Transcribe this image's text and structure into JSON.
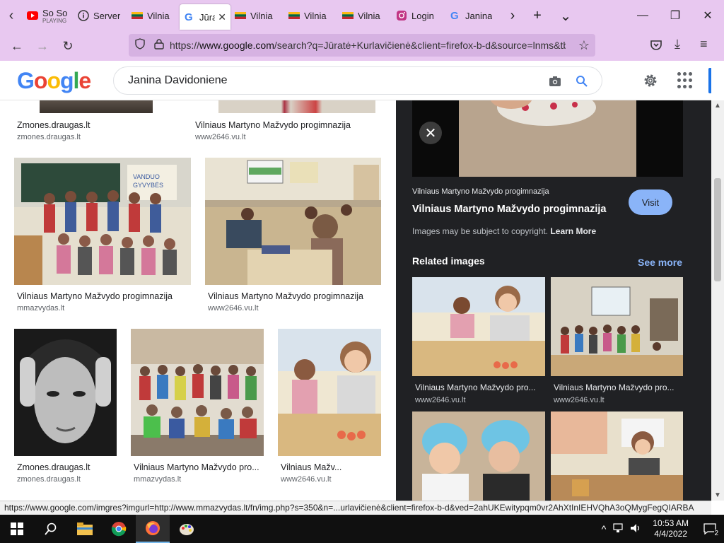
{
  "browser": {
    "tabs": [
      {
        "label": "So So",
        "sub": "PLAYING",
        "icon": "youtube-icon",
        "color": "#ff0000"
      },
      {
        "label": "Server",
        "icon": "info-icon",
        "color": "#333333"
      },
      {
        "label": "Vilnia",
        "icon": "lithuania-flag-icon",
        "color": "#fdb913"
      },
      {
        "label": "Jūrat",
        "icon": "google-icon",
        "color": "#4285f4",
        "active": true
      },
      {
        "label": "Vilnia",
        "icon": "lithuania-flag-icon",
        "color": "#fdb913"
      },
      {
        "label": "Vilnia",
        "icon": "lithuania-flag-icon",
        "color": "#fdb913"
      },
      {
        "label": "Vilnia",
        "icon": "lithuania-flag-icon",
        "color": "#fdb913"
      },
      {
        "label": "Login",
        "icon": "instagram-icon",
        "color": "#c13584"
      },
      {
        "label": "Janina",
        "icon": "google-icon",
        "color": "#4285f4"
      }
    ],
    "url_prefix": "https://",
    "url_domain": "www.google.com",
    "url_rest": "/search?q=Jūratė+Kurlavičienė&client=firefox-b-d&source=lnms&tb",
    "status_link": "https://www.google.com/imgres?imgurl=http://www.mmazvydas.lt/fn/img.php?s=350&n=...urlavičienė&client=firefox-b-d&ved=2ahUKEwitypqm0vr2AhXtInIEHVQhA3oQMygFegQIARBA"
  },
  "google": {
    "logo": "Google",
    "search_value": "Janina Davidoniene"
  },
  "results": [
    {
      "title": "Zmones.draugas.lt",
      "source": "zmones.draugas.lt"
    },
    {
      "title": "Vilniaus Martyno Mažvydo progimnazija",
      "source": "www2646.vu.lt"
    },
    {
      "title": "Vilniaus Martyno Mažvydo progimnazija",
      "source": "mmazvydas.lt"
    },
    {
      "title": "Vilniaus Martyno Mažvydo progimnazija",
      "source": "www2646.vu.lt"
    },
    {
      "title": "Zmones.draugas.lt",
      "source": "zmones.draugas.lt"
    },
    {
      "title": "Vilniaus Martyno Mažvydo pro...",
      "source": "mmazvydas.lt"
    },
    {
      "title": "Vilniaus Mažv...",
      "source": "www2646.vu.lt"
    }
  ],
  "panel": {
    "site": "Vilniaus Martyno Mažvydo progimnazija",
    "title": "Vilniaus Martyno Mažvydo progimnazija",
    "visit": "Visit",
    "copyright": "Images may be subject to copyright.",
    "learn_more": "Learn More",
    "related": "Related images",
    "see_more": "See more",
    "related_items": [
      {
        "title": "Vilniaus Martyno Mažvydo pro...",
        "source": "www2646.vu.lt"
      },
      {
        "title": "Vilniaus Martyno Mažvydo pro...",
        "source": "www2646.vu.lt"
      }
    ]
  },
  "taskbar": {
    "time": "10:53 AM",
    "date": "4/4/2022",
    "notifications": "2"
  }
}
